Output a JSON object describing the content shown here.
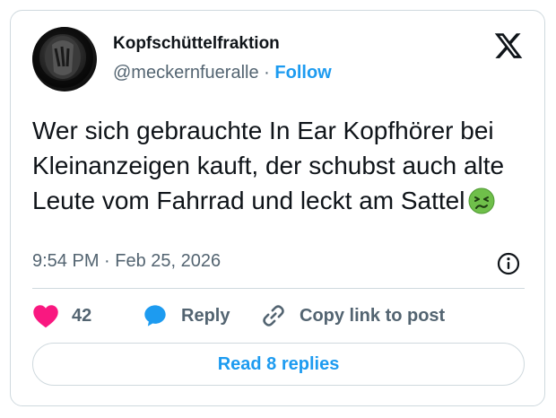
{
  "author": {
    "display_name": "Kopfschüttelfraktion",
    "handle": "@meckernfueralle",
    "separator": "·",
    "follow_label": "Follow"
  },
  "tweet": {
    "text": "Wer sich gebrauchte In Ear Kopfhörer bei Kleinanzeigen kauft, der schubst auch alte Leute vom Fahrrad und leckt am Sattel",
    "emoji_icon": "nauseated-face-icon",
    "time": "9:54 PM",
    "date_separator": "·",
    "date": "Feb 25, 2026"
  },
  "actions": {
    "like_count": "42",
    "reply_label": "Reply",
    "copy_link_label": "Copy link to post"
  },
  "read_replies_label": "Read 8 replies",
  "colors": {
    "accent": "#1d9bf0",
    "like": "#f91880",
    "text": "#0f1419",
    "secondary": "#536471",
    "border": "#cfd9de"
  }
}
